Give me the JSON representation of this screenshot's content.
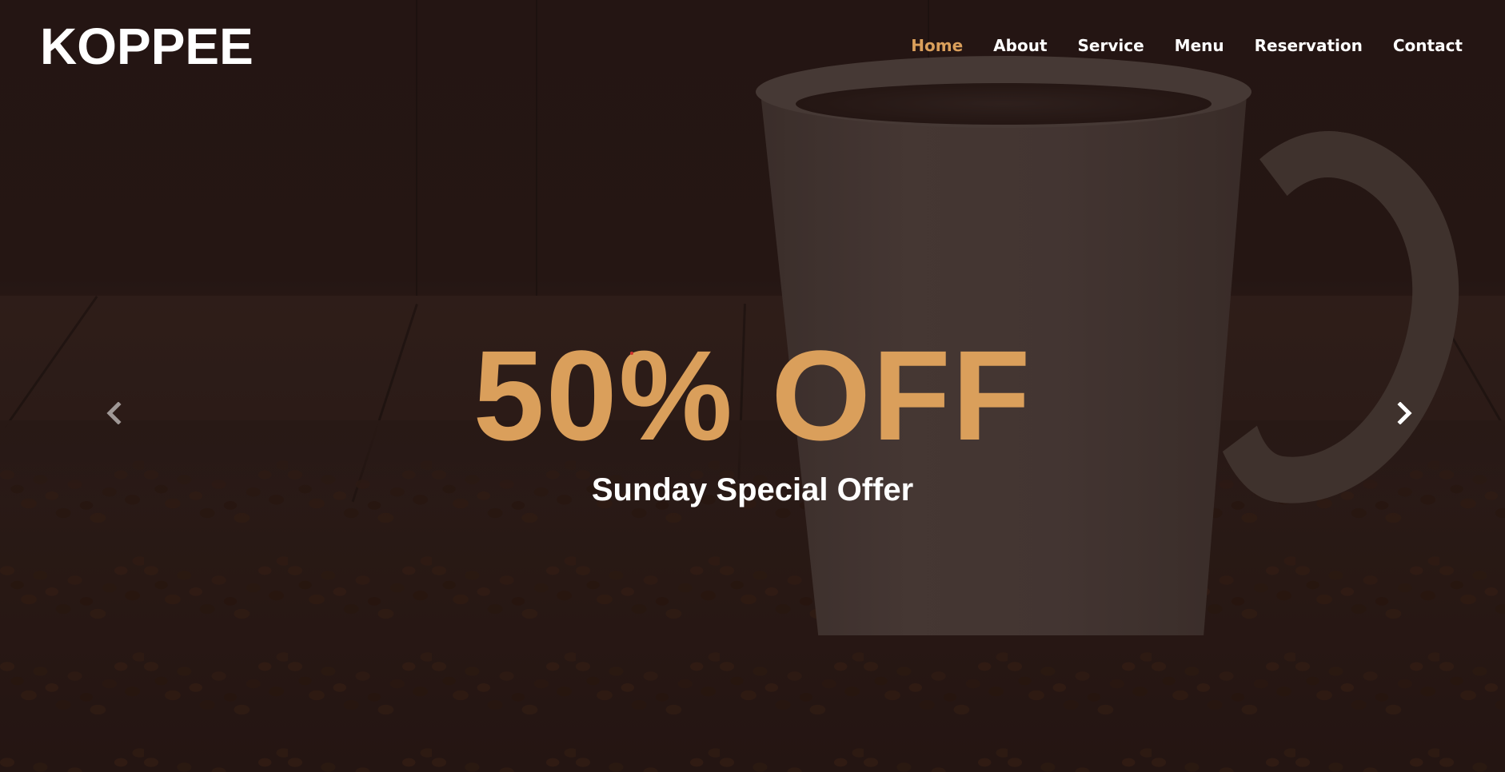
{
  "brand": {
    "logo_text": "KOPPEE"
  },
  "nav": {
    "items": [
      {
        "label": "Home",
        "active": true
      },
      {
        "label": "About",
        "active": false
      },
      {
        "label": "Service",
        "active": false
      },
      {
        "label": "Menu",
        "active": false
      },
      {
        "label": "Reservation",
        "active": false
      },
      {
        "label": "Contact",
        "active": false
      }
    ]
  },
  "carousel": {
    "title": "50% OFF",
    "subtitle": "Sunday Special Offer",
    "prev_icon": "chevron-left-icon",
    "next_icon": "chevron-right-icon"
  },
  "colors": {
    "accent": "#DA9F5B",
    "text": "#FFFFFF",
    "background": "#2B1B18"
  }
}
